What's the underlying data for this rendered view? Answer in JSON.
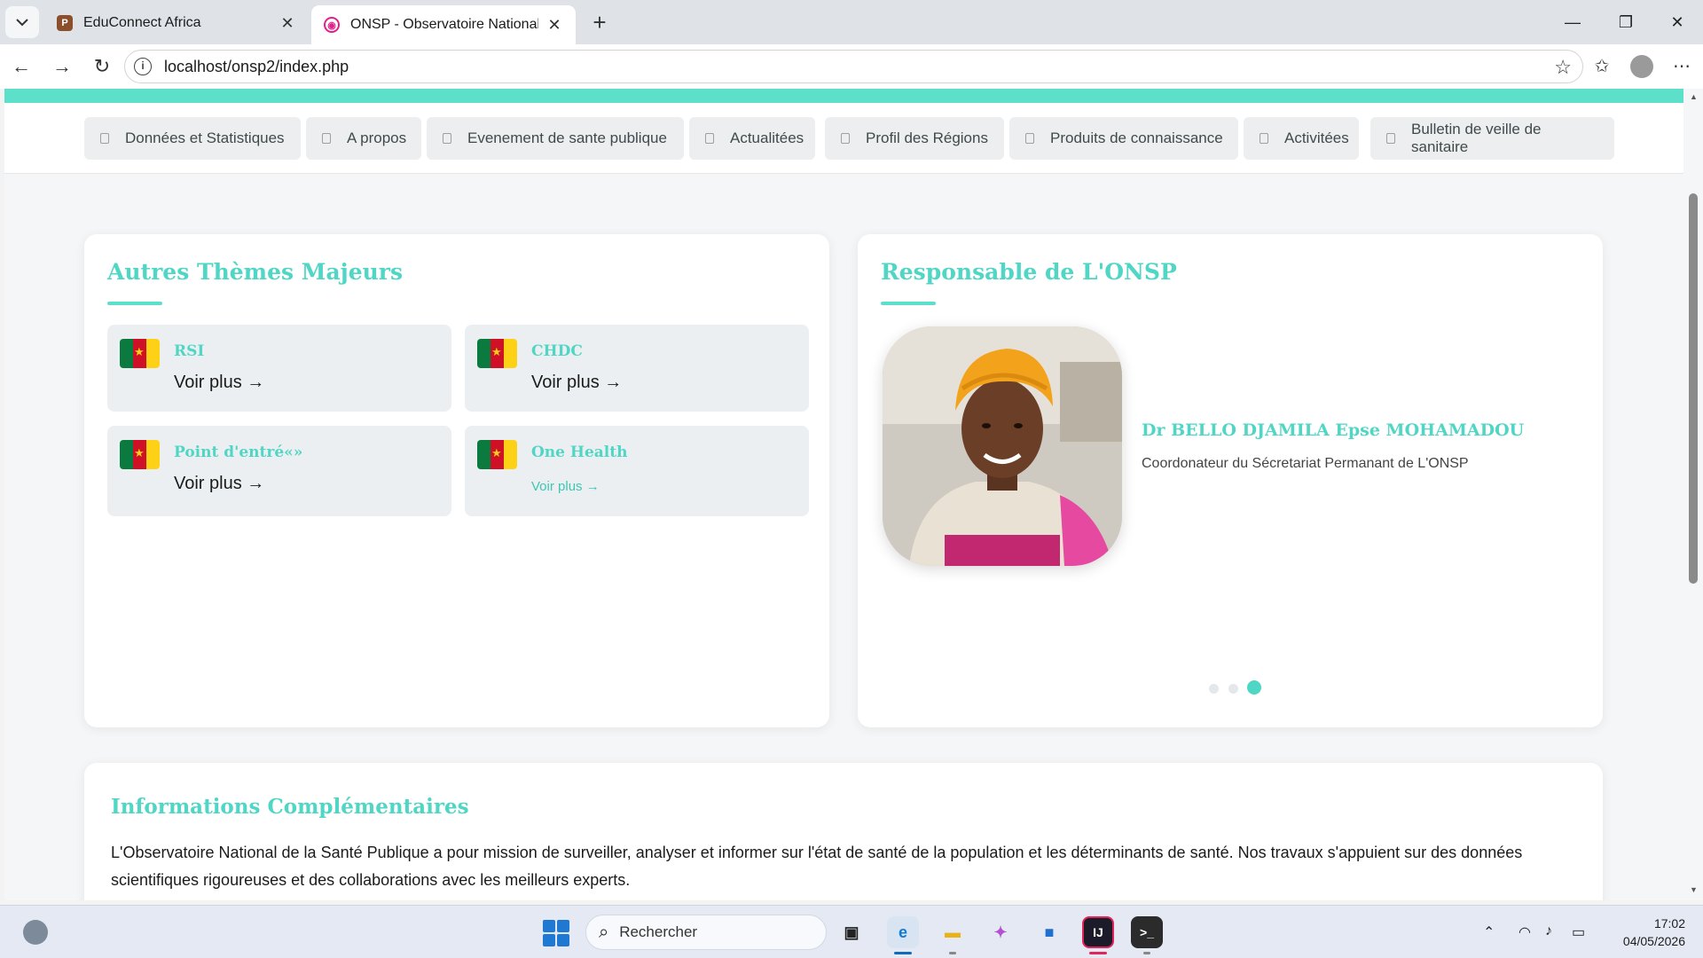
{
  "browser": {
    "tabs": [
      {
        "title": "EduConnect Africa",
        "icon": "educonnect-favicon",
        "active": false
      },
      {
        "title": "ONSP - Observatoire National de l",
        "icon": "onsp-favicon",
        "active": true
      }
    ],
    "url": "localhost/onsp2/index.php"
  },
  "nav": {
    "items": [
      {
        "label": "Données et Statistiques"
      },
      {
        "label": "A propos"
      },
      {
        "label": "Evenement de sante publique"
      },
      {
        "label": "Actualitées"
      },
      {
        "label": "Profil des Régions"
      },
      {
        "label": "Produits de connaissance"
      },
      {
        "label": "Activitées"
      },
      {
        "label": "Bulletin de veille de sanitaire"
      }
    ]
  },
  "themes": {
    "title": "Autres Thèmes Majeurs",
    "items": [
      {
        "name": "RSI",
        "more": "Voir plus →"
      },
      {
        "name": "CHDC",
        "more": "Voir plus →"
      },
      {
        "name": "Point d'entré«»",
        "more": "Voir plus →"
      },
      {
        "name": "One Health",
        "more": "Voir plus →"
      }
    ]
  },
  "responsable": {
    "title": "Responsable de L'ONSP",
    "name": "Dr BELLO DJAMILA Epse MOHAMADOU",
    "role": "Coordonateur du Sécretariat Permanant de L'ONSP",
    "carousel_active_index": 3,
    "carousel_total": 3
  },
  "info": {
    "title": "Informations Complémentaires",
    "text": "L'Observatoire National de la Santé Publique a pour mission de surveiller, analyser et informer sur l'état de santé de la population et les déterminants de santé. Nos travaux s'appuient sur des données scientifiques rigoureuses et des collaborations avec les meilleurs experts."
  },
  "colors": {
    "accent": "#4fd6c4",
    "accent_bar": "#5ce0c9",
    "flag_green": "#0b7a3e",
    "flag_red": "#ce1126",
    "flag_yellow": "#fcd116"
  },
  "taskbar": {
    "search_label": "Rechercher",
    "time": "17:02",
    "date": "04/05/2026"
  }
}
